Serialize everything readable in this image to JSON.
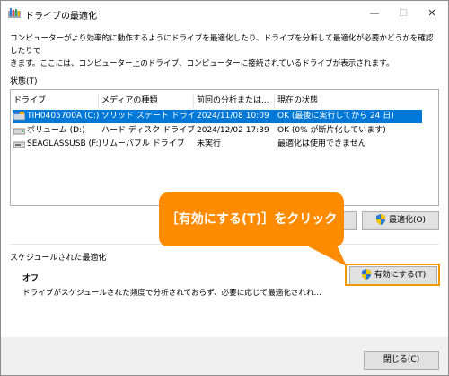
{
  "window": {
    "title": "ドライブの最適化",
    "controls": {
      "minimize": "—",
      "maximize": "☐",
      "close": "✕"
    }
  },
  "description": [
    "コンピューターがより効率的に動作するようにドライブを最適化したり、ドライブを分析して最適化が必要かどうかを確認したりで",
    "きます。ここには、コンピューター上のドライブ、コンピューターに接続されているドライブが表示されます。"
  ],
  "status": {
    "label": "状態(T)",
    "columns": [
      "ドライブ",
      "メディアの種類",
      "前回の分析または...",
      "現在の状態"
    ],
    "rows": [
      {
        "drive": "TIH0405700A (C:)",
        "media": "ソリッド ステート ドライブ",
        "last": "2024/11/08 10:09",
        "state": "OK (最後に実行してから 24 日)",
        "icon": "ssd-drive-icon",
        "selected": true
      },
      {
        "drive": "ボリューム (D:)",
        "media": "ハード ディスク ドライブ",
        "last": "2024/12/02 17:39",
        "state": "OK (0% が断片化しています)",
        "icon": "hdd-drive-icon",
        "selected": false
      },
      {
        "drive": "SEAGLASSUSB (F:)",
        "media": "リムーバブル ドライブ",
        "last": "未実行",
        "state": "最適化は使用できません",
        "icon": "usb-drive-icon",
        "selected": false
      }
    ]
  },
  "buttons": {
    "analyze": "",
    "optimize": "最適化(O)",
    "enable": "有効にする(T)",
    "close": "閉じる(C)"
  },
  "schedule": {
    "label": "スケジュールされた最適化",
    "state": "オフ",
    "description": "ドライブがスケジュールされた頻度で分析されておらず、必要に応じて最適化されれ..."
  },
  "callout": {
    "text": "［有効にする(T)］をクリック",
    "color": "#ff8c00"
  },
  "colors": {
    "selection": "#0078d7",
    "accent": "#ff8c00",
    "highlight_border": "#f39800"
  }
}
